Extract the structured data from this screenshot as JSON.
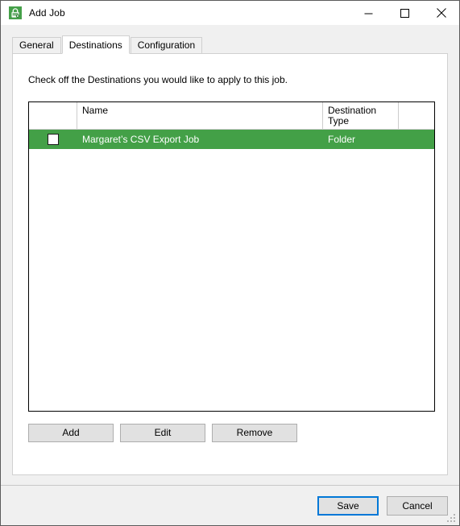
{
  "window": {
    "title": "Add Job",
    "icon": "app-lock-icon",
    "controls": {
      "minimize": "minimize-icon",
      "maximize": "maximize-icon",
      "close": "close-icon"
    }
  },
  "tabs": [
    {
      "label": "General",
      "selected": false
    },
    {
      "label": "Destinations",
      "selected": true
    },
    {
      "label": "Configuration",
      "selected": false
    }
  ],
  "panel": {
    "instruction": "Check off the Destinations you would like to apply to this job."
  },
  "grid": {
    "columns": [
      {
        "key": "check",
        "label": ""
      },
      {
        "key": "name",
        "label": "Name"
      },
      {
        "key": "type",
        "label": "Destination\nType"
      },
      {
        "key": "last",
        "label": ""
      }
    ],
    "column_headers": {
      "check": "",
      "name": "Name",
      "type_line1": "Destination",
      "type_line2": "Type",
      "last": ""
    },
    "rows": [
      {
        "checked": false,
        "name": "Margaret’s CSV Export Job",
        "destination_type": "Folder",
        "selected": true
      }
    ]
  },
  "grid_actions": {
    "add": "Add",
    "edit": "Edit",
    "remove": "Remove"
  },
  "footer": {
    "save": "Save",
    "cancel": "Cancel"
  },
  "colors": {
    "selection_green": "#43a047",
    "focus_blue": "#0078d7",
    "window_bg": "#f0f0f0",
    "panel_bg": "#ffffff"
  }
}
